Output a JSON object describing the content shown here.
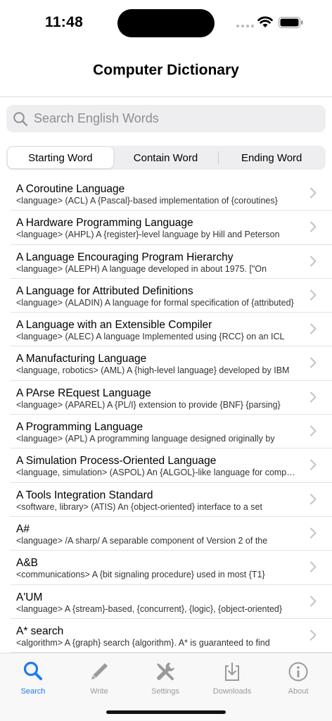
{
  "status": {
    "time": "11:48"
  },
  "nav": {
    "title": "Computer Dictionary"
  },
  "search": {
    "placeholder": "Search English Words",
    "value": ""
  },
  "segments": [
    {
      "label": "Starting Word",
      "selected": true
    },
    {
      "label": "Contain Word",
      "selected": false
    },
    {
      "label": "Ending Word",
      "selected": false
    }
  ],
  "entries": [
    {
      "title": "A Coroutine Language",
      "sub": "<language> (ACL) A {Pascal}-based implementation of {coroutines}"
    },
    {
      "title": "A Hardware Programming Language",
      "sub": "<language> (AHPL) A {register}-level language by Hill and Peterson"
    },
    {
      "title": "A Language Encouraging Program Hierarchy",
      "sub": "<language> (ALEPH) A language developed in about 1975.    [\"On"
    },
    {
      "title": "A Language for Attributed Definitions",
      "sub": "<language> (ALADIN) A language for formal specification of {attributed}"
    },
    {
      "title": "A Language with an Extensible Compiler",
      "sub": "<language> (ALEC) A language Implemented using {RCC} on an ICL"
    },
    {
      "title": "A Manufacturing Language",
      "sub": "<language, robotics> (AML) A {high-level language} developed by IBM"
    },
    {
      "title": "A PArse REquest Language",
      "sub": "<language> (APAREL) A {PL/I} extension to provide {BNF} {parsing}"
    },
    {
      "title": "A Programming Language",
      "sub": "<language> (APL) A programming language designed originally by"
    },
    {
      "title": "A Simulation Process-Oriented Language",
      "sub": "<language, simulation> (ASPOL) An {ALGOL}-like language for computer"
    },
    {
      "title": "A Tools Integration Standard",
      "sub": "<software, library> (ATIS) An {object-oriented} interface to a set"
    },
    {
      "title": "A#",
      "sub": "<language> /A sharp/ A separable component of Version 2 of the"
    },
    {
      "title": "A&B",
      "sub": "<communications> A {bit signaling procedure} used in most {T1}"
    },
    {
      "title": "A'UM",
      "sub": "<language> A {stream}-based, {concurrent}, {logic}, {object-oriented}"
    },
    {
      "title": "A* search",
      "sub": "<algorithm> A {graph} search {algorithm}.  A* is guaranteed to find"
    }
  ],
  "tabs": [
    {
      "label": "Search",
      "icon": "search-icon",
      "active": true
    },
    {
      "label": "Write",
      "icon": "pencil-icon",
      "active": false
    },
    {
      "label": "Settings",
      "icon": "tools-icon",
      "active": false
    },
    {
      "label": "Downloads",
      "icon": "download-icon",
      "active": false
    },
    {
      "label": "About",
      "icon": "info-icon",
      "active": false
    }
  ],
  "colors": {
    "accent": "#1a7cf0",
    "inactive": "#9a9a9e"
  }
}
